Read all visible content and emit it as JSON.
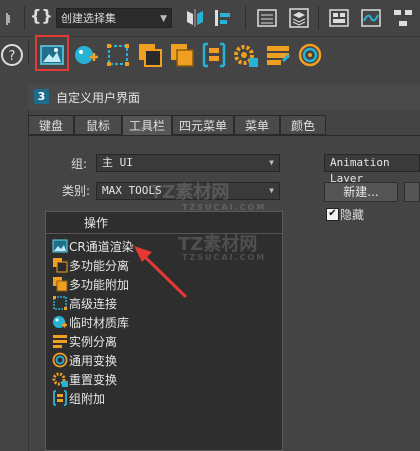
{
  "toolbar": {
    "selection_set_label": "创建选择集"
  },
  "dialog": {
    "title": "自定义用户界面",
    "tabs": [
      "键盘",
      "鼠标",
      "工具栏",
      "四元菜单",
      "菜单",
      "颜色"
    ],
    "active_tab": "工具栏",
    "group_label": "组:",
    "group_value": "主 UI",
    "category_label": "类别:",
    "category_value": "MAX TOOLS",
    "toolbar_combo_value": "Animation Layer",
    "new_button": "新建...",
    "hide_checkbox_label": "隐藏",
    "hide_checked": true,
    "actions_header": "操作",
    "actions": [
      {
        "label": "CR通道渲染",
        "icon": "render-channel-icon"
      },
      {
        "label": "多功能分离",
        "icon": "detach-icon"
      },
      {
        "label": "多功能附加",
        "icon": "attach-icon"
      },
      {
        "label": "高级连接",
        "icon": "advanced-connect-icon"
      },
      {
        "label": "临时材质库",
        "icon": "temp-material-library-icon"
      },
      {
        "label": "实例分离",
        "icon": "instance-detach-icon"
      },
      {
        "label": "通用变换",
        "icon": "universal-transform-icon"
      },
      {
        "label": "重置变换",
        "icon": "reset-transform-icon"
      },
      {
        "label": "组附加",
        "icon": "group-attach-icon"
      }
    ]
  },
  "watermark": {
    "brand": "TZ素材网",
    "url": "TZSUCAI.COM"
  },
  "colors": {
    "accent_orange": "#f0a020",
    "accent_cyan": "#27b3d6",
    "highlight_red": "#e53935"
  }
}
